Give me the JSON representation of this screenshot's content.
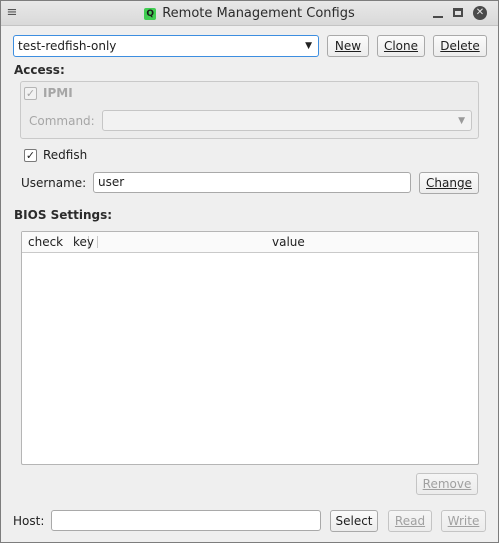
{
  "window": {
    "title": "Remote Management Configs",
    "menu_icon": "menu-icon",
    "logo_text": "Q",
    "controls": [
      "minimize",
      "maximize",
      "close"
    ]
  },
  "config": {
    "selected": "test-redfish-only",
    "new_label": "New",
    "clone_label": "Clone",
    "delete_label": "Delete"
  },
  "access": {
    "heading": "Access:",
    "ipmi_label": "IPMI",
    "ipmi_checked": true,
    "command_label": "Command:",
    "command_value": "",
    "redfish_label": "Redfish",
    "redfish_checked": true,
    "username_label": "Username:",
    "username_value": "user",
    "change_label": "Change"
  },
  "bios": {
    "heading": "BIOS Settings:",
    "columns": [
      "check",
      "key",
      "value"
    ],
    "rows": [],
    "remove_label": "Remove"
  },
  "host": {
    "label": "Host:",
    "value": "",
    "select_label": "Select",
    "read_label": "Read",
    "write_label": "Write"
  }
}
